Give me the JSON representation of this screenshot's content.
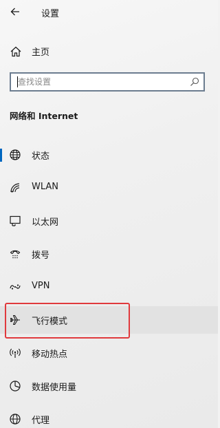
{
  "header": {
    "back_icon": "arrow-left-icon",
    "title": "设置"
  },
  "home": {
    "icon": "home-icon",
    "label": "主页"
  },
  "search": {
    "placeholder": "查找设置",
    "value": "",
    "icon": "search-icon"
  },
  "section_title": "网络和 Internet",
  "nav": {
    "items": [
      {
        "label": "状态",
        "icon": "globe-icon"
      },
      {
        "label": "WLAN",
        "icon": "wifi-icon"
      },
      {
        "label": "以太网",
        "icon": "ethernet-icon"
      },
      {
        "label": "拨号",
        "icon": "dialup-icon"
      },
      {
        "label": "VPN",
        "icon": "vpn-icon"
      },
      {
        "label": "飞行模式",
        "icon": "airplane-icon"
      },
      {
        "label": "移动热点",
        "icon": "hotspot-icon"
      },
      {
        "label": "数据使用量",
        "icon": "data-usage-icon"
      },
      {
        "label": "代理",
        "icon": "globe-icon"
      }
    ]
  },
  "colors": {
    "accent": "#0067c0",
    "highlight_border": "#e0393c"
  }
}
